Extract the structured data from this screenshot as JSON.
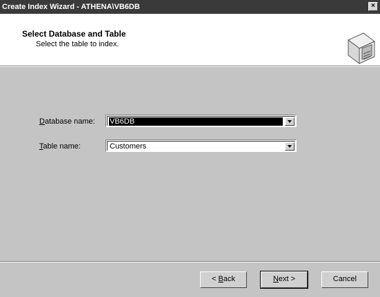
{
  "window": {
    "title": "Create Index Wizard - ATHENA\\VB6DB",
    "close_glyph": "×"
  },
  "header": {
    "title": "Select Database and Table",
    "subtitle": "Select the table to index.",
    "icon": "wizard-disk-icon"
  },
  "form": {
    "database": {
      "label_prefix": "",
      "label_accel": "D",
      "label_rest": "atabase name:",
      "value": "VB6DB"
    },
    "table": {
      "label_prefix": "",
      "label_accel": "T",
      "label_rest": "able name:",
      "value": "Customers"
    }
  },
  "buttons": {
    "back": {
      "lead": "< ",
      "accel": "B",
      "rest": "ack"
    },
    "next": {
      "lead": "",
      "accel": "N",
      "rest": "ext >"
    },
    "cancel": "Cancel"
  }
}
